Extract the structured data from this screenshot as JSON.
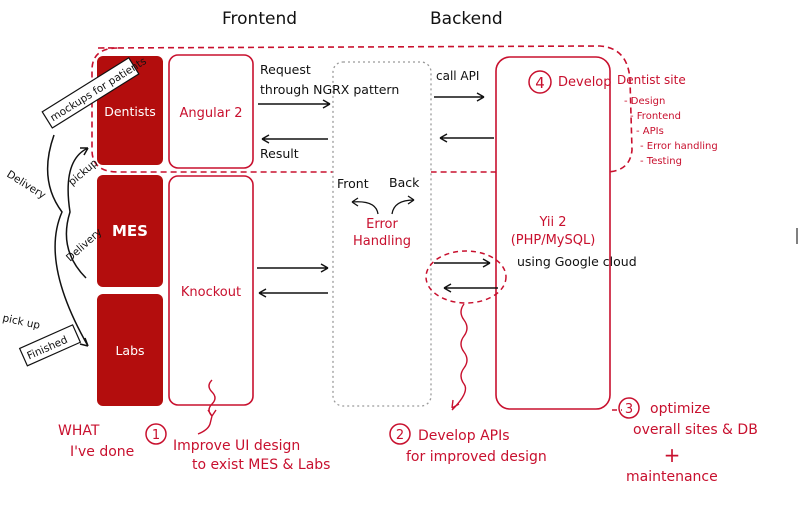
{
  "headers": {
    "frontend": "Frontend",
    "backend": "Backend"
  },
  "boxes": {
    "dentists": "Dentists",
    "mes": "MES",
    "labs": "Labs",
    "angular": "Angular 2",
    "knockout": "Knockout",
    "error_handling_line1": "Error",
    "error_handling_line2": "Handling",
    "front": "Front",
    "back": "Back",
    "yii_line1": "Yii 2",
    "yii_line2": "(PHP/MySQL)",
    "google_cloud": "using Google cloud"
  },
  "arrows": {
    "request_line1": "Request",
    "request_line2": "through NGRX pattern",
    "result": "Result",
    "call_api": "call API"
  },
  "side_notes": {
    "mockups": "mockups for patients",
    "delivery_top": "Delivery",
    "pickup_top": "pickup",
    "delivery_mid": "Delivery",
    "pick_up": "pick up",
    "finished": "Finished"
  },
  "annotations": {
    "what_line1": "WHAT",
    "what_line2": "I've done",
    "step1_number": "1",
    "step1_line1": "Improve UI design",
    "step1_line2": "to exist MES & Labs",
    "step2_number": "2",
    "step2_line1": "Develop APIs",
    "step2_line2": "for improved design",
    "step3_number": "3",
    "step3_line1": "optimize",
    "step3_line2": "overall sites & DB",
    "step3_plus": "+",
    "step3_line3": "maintenance",
    "step4_number": "4",
    "step4_title": "Develop",
    "dentist_site_title": "Dentist site",
    "dentist_site_items": [
      "- Design",
      "- Frontend",
      "- APIs",
      "- Error handling",
      "- Testing"
    ]
  },
  "colors": {
    "accent_red": "#c8102e",
    "box_fill_red": "#b30d0d",
    "ink": "#111111",
    "dotted_gray": "#9a9a9a"
  }
}
